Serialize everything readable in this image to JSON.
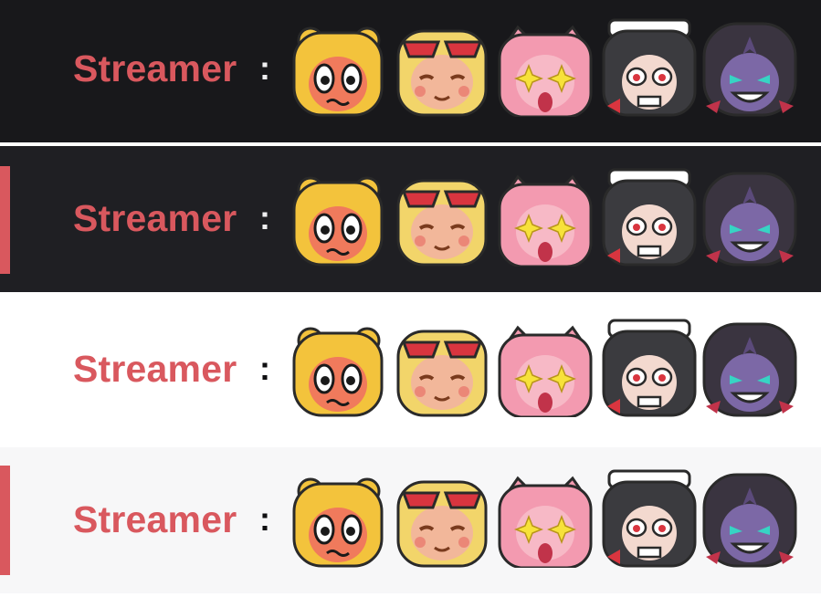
{
  "rows": [
    {
      "theme": "dark",
      "background": "#18181b",
      "text_color": "#efeff1",
      "selected": false,
      "name": "Streamer",
      "separator": ":"
    },
    {
      "theme": "dark",
      "background": "#1f1f23",
      "text_color": "#efeff1",
      "selected": true,
      "name": "Streamer",
      "separator": ":"
    },
    {
      "theme": "light",
      "background": "#ffffff",
      "text_color": "#0e0e10",
      "selected": false,
      "name": "Streamer",
      "separator": ":"
    },
    {
      "theme": "light",
      "background": "#f7f7f8",
      "text_color": "#0e0e10",
      "selected": true,
      "name": "Streamer",
      "separator": ":"
    }
  ],
  "emotes": [
    {
      "name": "tiger-girl-emote",
      "colors": {
        "hair": "#f3c33c",
        "face": "#f07a5c",
        "accent": "#1a1a1a"
      }
    },
    {
      "name": "goggles-girl-emote",
      "colors": {
        "hair": "#f2d56a",
        "face": "#f2b79a",
        "accent": "#d9353f"
      }
    },
    {
      "name": "pink-starry-eyes-emote",
      "colors": {
        "hair": "#f39ab0",
        "face": "#f7b9c6",
        "accent": "#f7e23a"
      }
    },
    {
      "name": "maid-girl-emote",
      "colors": {
        "hair": "#3b3b3f",
        "face": "#f3d9cf",
        "accent": "#d9353f"
      }
    },
    {
      "name": "dark-grin-emote",
      "colors": {
        "hair": "#3a3440",
        "face": "#7c68a6",
        "accent": "#37d4c4"
      }
    }
  ],
  "accent_color": "#d9585e"
}
